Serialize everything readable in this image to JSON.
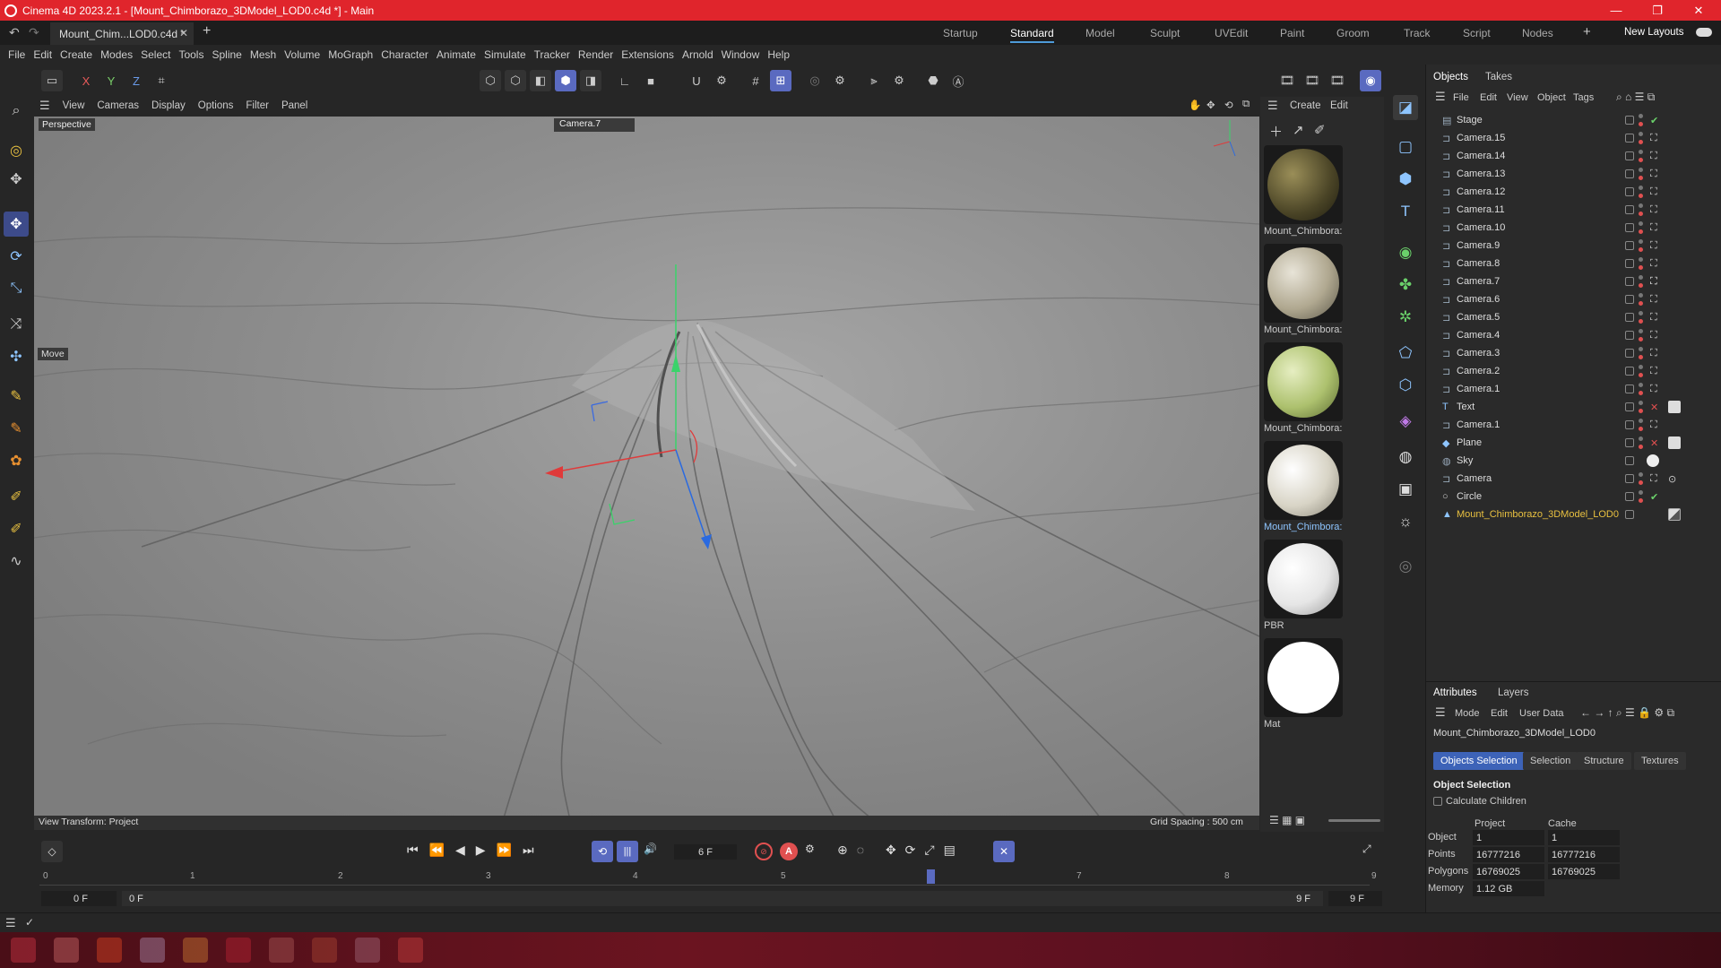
{
  "window": {
    "title": "Cinema 4D 2023.2.1 - [Mount_Chimborazo_3DModel_LOD0.c4d *] - Main",
    "doc_tab": "Mount_Chim...LOD0.c4d *"
  },
  "layouts": [
    "Startup",
    "Standard",
    "Model",
    "Sculpt",
    "UVEdit",
    "Paint",
    "Groom",
    "Track",
    "Script",
    "Nodes"
  ],
  "layouts_active": "Standard",
  "new_layouts_label": "New Layouts",
  "menu": [
    "File",
    "Edit",
    "Create",
    "Modes",
    "Select",
    "Tools",
    "Spline",
    "Mesh",
    "Volume",
    "MoGraph",
    "Character",
    "Animate",
    "Simulate",
    "Tracker",
    "Render",
    "Extensions",
    "Arnold",
    "Window",
    "Help"
  ],
  "axis_toggles": [
    "X",
    "Y",
    "Z"
  ],
  "viewport": {
    "menu": [
      "View",
      "Cameras",
      "Display",
      "Options",
      "Filter",
      "Panel"
    ],
    "projection": "Perspective",
    "camera": "Camera.7",
    "tool_label": "Move",
    "view_transform": "View Transform: Project",
    "grid_spacing": "Grid Spacing : 500 cm"
  },
  "materials": {
    "menu": [
      "Create",
      "Edit"
    ],
    "items": [
      {
        "name": "Mount_Chimbora:",
        "color": "#5a5332"
      },
      {
        "name": "Mount_Chimbora:",
        "color": "#b8b2a0"
      },
      {
        "name": "Mount_Chimbora:",
        "color": "#b3c27a"
      },
      {
        "name": "Mount_Chimbora:",
        "color": "#d9d6c8"
      },
      {
        "name": "PBR",
        "color": "#eeeeee"
      },
      {
        "name": "Mat",
        "color": "#ffffff"
      }
    ]
  },
  "objects_panel": {
    "tabs": [
      "Objects",
      "Takes"
    ],
    "menu": [
      "File",
      "Edit",
      "View",
      "Object",
      "Tags"
    ],
    "items": [
      {
        "name": "Stage",
        "icon": "stage-icon",
        "tag": "✔"
      },
      {
        "name": "Camera.15",
        "icon": "camera-icon",
        "tag": "⛶"
      },
      {
        "name": "Camera.14",
        "icon": "camera-icon",
        "tag": "⛶"
      },
      {
        "name": "Camera.13",
        "icon": "camera-icon",
        "tag": "⛶"
      },
      {
        "name": "Camera.12",
        "icon": "camera-icon",
        "tag": "⛶"
      },
      {
        "name": "Camera.11",
        "icon": "camera-icon",
        "tag": "⛶"
      },
      {
        "name": "Camera.10",
        "icon": "camera-icon",
        "tag": "⛶"
      },
      {
        "name": "Camera.9",
        "icon": "camera-icon",
        "tag": "⛶"
      },
      {
        "name": "Camera.8",
        "icon": "camera-icon",
        "tag": "⛶"
      },
      {
        "name": "Camera.7",
        "icon": "camera-icon",
        "tag": "⛶"
      },
      {
        "name": "Camera.6",
        "icon": "camera-icon",
        "tag": "⛶"
      },
      {
        "name": "Camera.5",
        "icon": "camera-icon",
        "tag": "⛶"
      },
      {
        "name": "Camera.4",
        "icon": "camera-icon",
        "tag": "⛶"
      },
      {
        "name": "Camera.3",
        "icon": "camera-icon",
        "tag": "⛶"
      },
      {
        "name": "Camera.2",
        "icon": "camera-icon",
        "tag": "⛶"
      },
      {
        "name": "Camera.1",
        "icon": "camera-icon",
        "tag": "⛶"
      },
      {
        "name": "Text",
        "icon": "text-icon",
        "tag": "✕"
      },
      {
        "name": "Camera.1",
        "icon": "camera-icon",
        "tag": "⛶"
      },
      {
        "name": "Plane",
        "icon": "plane-icon",
        "tag": "✕"
      },
      {
        "name": "Sky",
        "icon": "sky-icon",
        "tag": ""
      },
      {
        "name": "Camera",
        "icon": "camera-icon",
        "tag": "⛶"
      },
      {
        "name": "Circle",
        "icon": "circle-icon",
        "tag": "✔"
      },
      {
        "name": "Mount_Chimborazo_3DModel_LOD0",
        "icon": "mesh-icon",
        "tag": ""
      }
    ]
  },
  "attributes": {
    "tabs": [
      "Attributes",
      "Layers"
    ],
    "menu": [
      "Mode",
      "Edit",
      "User Data"
    ],
    "object_name": "Mount_Chimborazo_3DModel_LOD0",
    "subtabs": [
      "Objects Selection",
      "Selection",
      "Structure",
      "Textures"
    ],
    "section": "Object Selection",
    "calc_children": "Calculate Children",
    "col_project": "Project",
    "col_cache": "Cache",
    "rows": [
      {
        "label": "Object",
        "project": "1",
        "cache": "1"
      },
      {
        "label": "Points",
        "project": "16777216",
        "cache": "16777216"
      },
      {
        "label": "Polygons",
        "project": "16769025",
        "cache": "16769025"
      },
      {
        "label": "Memory",
        "project": "1.12 GB",
        "cache": ""
      }
    ]
  },
  "timeline": {
    "current_frame": "6 F",
    "start": "0 F",
    "range_start": "0 F",
    "range_end": "9 F",
    "end": "9 F",
    "ticks": [
      "1",
      "2",
      "3",
      "4",
      "5",
      "6",
      "7",
      "8",
      "9"
    ],
    "playhead_frame": 6
  }
}
